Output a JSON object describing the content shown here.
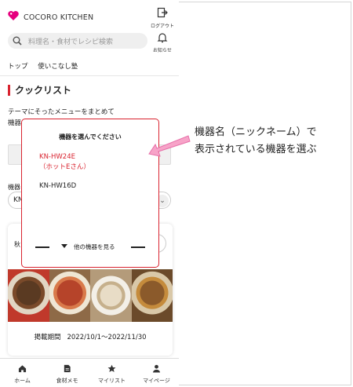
{
  "app": {
    "brand": "COCORO KITCHEN",
    "logout_label": "ログアウト",
    "notify_label": "お知らせ"
  },
  "search": {
    "placeholder": "料理名・食材でレシピ検索"
  },
  "nav": {
    "items": [
      "トップ",
      "使いこなし塾"
    ]
  },
  "page": {
    "title": "クックリスト",
    "desc_line1": "テーマにそったメニューをまとめて",
    "desc_line2": "機器"
  },
  "device_select": {
    "label": "機器",
    "value": "KN",
    "chevron": "⌄"
  },
  "card": {
    "prefix": "秋",
    "period_label": "掲載期間",
    "period_value": "2022/10/1～2022/11/30"
  },
  "modal": {
    "title": "機器を選んでください",
    "options": [
      {
        "line1": "KN-HW24E",
        "line2": "（ホットEさん）",
        "selected": true
      },
      {
        "line1": "KN-HW16D",
        "line2": "",
        "selected": false
      }
    ],
    "more_label": "他の機器を見る"
  },
  "bottom_nav": {
    "items": [
      {
        "label": "ホーム",
        "icon": "home-icon"
      },
      {
        "label": "食材メモ",
        "icon": "memo-icon"
      },
      {
        "label": "マイリスト",
        "icon": "star-icon"
      },
      {
        "label": "マイページ",
        "icon": "person-icon"
      }
    ]
  },
  "annotation": {
    "line1": "機器名（ニックネーム）で",
    "line2": "表示されている機器を選ぶ"
  },
  "colors": {
    "accent": "#d9232f",
    "arrow_pink": "#f7a3c8",
    "logo_magenta": "#e6007e"
  }
}
